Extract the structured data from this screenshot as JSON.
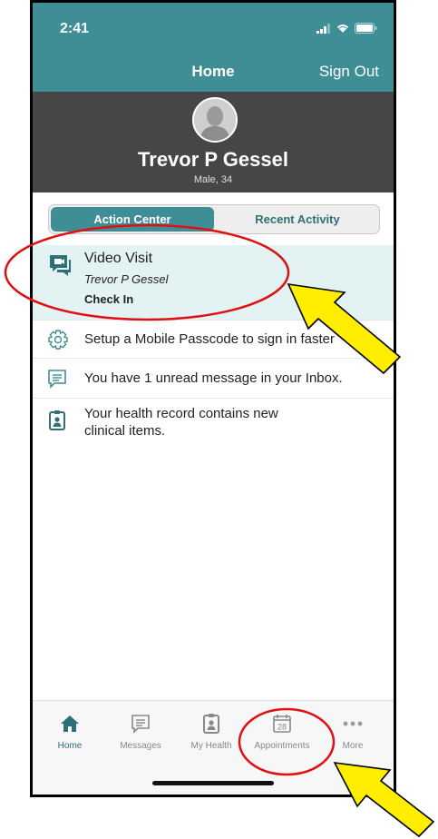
{
  "status_bar": {
    "time": "2:41"
  },
  "nav": {
    "title": "Home",
    "sign_out": "Sign Out"
  },
  "profile": {
    "name": "Trevor P Gessel",
    "info": "Male, 34"
  },
  "segments": {
    "action_center": "Action Center",
    "recent_activity": "Recent Activity"
  },
  "action_items": [
    {
      "title": "Video Visit",
      "patient": "Trevor P Gessel",
      "action": "Check In",
      "icon": "video-chat-icon"
    },
    {
      "text": "Setup a Mobile Passcode to sign in faster",
      "icon": "gear-icon"
    },
    {
      "text": "You have 1 unread message in your Inbox.",
      "icon": "message-icon"
    },
    {
      "text": "Your health record contains new clinical items.",
      "line1": "Your health record contains new",
      "line2": "clinical items.",
      "icon": "health-record-icon"
    }
  ],
  "tabbar": [
    {
      "label": "Home",
      "icon": "home-icon"
    },
    {
      "label": "Messages",
      "icon": "messages-icon"
    },
    {
      "label": "My Health",
      "icon": "my-health-icon"
    },
    {
      "label": "Appointments",
      "icon": "calendar-icon",
      "day": "28"
    },
    {
      "label": "More",
      "icon": "more-icon"
    }
  ],
  "colors": {
    "accent": "#3f8e96",
    "header_dark": "#464646",
    "highlight": "#e3f2f3",
    "annotation_circle": "#e01010",
    "annotation_arrow": "#ffee00"
  }
}
